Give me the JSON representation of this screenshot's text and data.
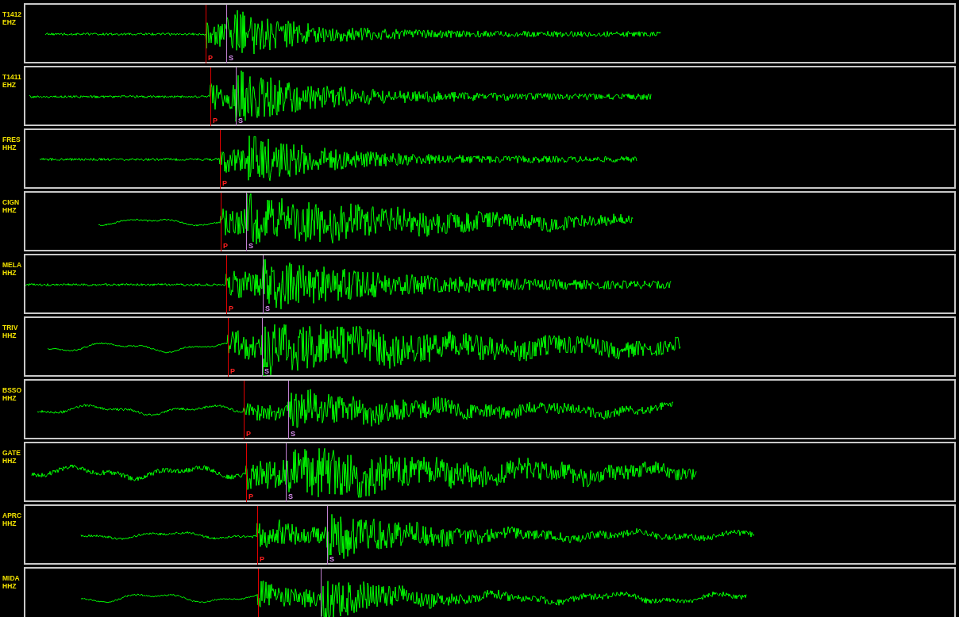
{
  "traces": [
    {
      "station": "T1412",
      "channel": "EHZ",
      "picks": [
        {
          "kind": "p",
          "label": "P"
        },
        {
          "kind": "s",
          "label": "S"
        }
      ]
    },
    {
      "station": "T1411",
      "channel": "EHZ",
      "picks": [
        {
          "kind": "p",
          "label": "P"
        },
        {
          "kind": "s",
          "label": "S"
        }
      ]
    },
    {
      "station": "FRES",
      "channel": "HHZ",
      "picks": [
        {
          "kind": "p",
          "label": "P"
        }
      ]
    },
    {
      "station": "CIGN",
      "channel": "HHZ",
      "picks": [
        {
          "kind": "p",
          "label": "P"
        },
        {
          "kind": "s",
          "label": "S"
        }
      ]
    },
    {
      "station": "MELA",
      "channel": "HHZ",
      "picks": [
        {
          "kind": "p",
          "label": "P"
        },
        {
          "kind": "s",
          "label": "S"
        }
      ]
    },
    {
      "station": "TRIV",
      "channel": "HHZ",
      "picks": [
        {
          "kind": "p",
          "label": "P"
        },
        {
          "kind": "s",
          "label": "S"
        }
      ]
    },
    {
      "station": "BSSO",
      "channel": "HHZ",
      "picks": [
        {
          "kind": "p",
          "label": "P"
        },
        {
          "kind": "s",
          "label": "S"
        }
      ]
    },
    {
      "station": "GATE",
      "channel": "HHZ",
      "picks": [
        {
          "kind": "p",
          "label": "P"
        },
        {
          "kind": "s",
          "label": "S"
        }
      ]
    },
    {
      "station": "APRC",
      "channel": "HHZ",
      "picks": [
        {
          "kind": "p",
          "label": "P"
        },
        {
          "kind": "s",
          "label": "S"
        }
      ]
    },
    {
      "station": "MIDA",
      "channel": "HHZ",
      "picks": [
        {
          "kind": "p"
        },
        {
          "kind": "s"
        }
      ]
    }
  ]
}
